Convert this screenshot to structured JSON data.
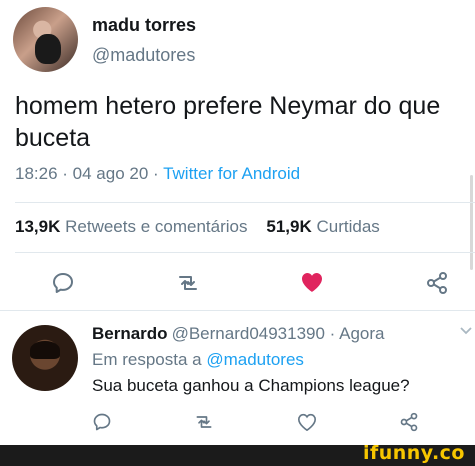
{
  "tweet": {
    "author_name": "madu torres",
    "author_handle": "@madutores",
    "text": "homem hetero prefere Neymar do que buceta",
    "time": "18:26 · 04 ago 20 · ",
    "source": "Twitter for Android",
    "retweets_count": "13,9K",
    "retweets_label": "Retweets e comentários",
    "likes_count": "51,9K",
    "likes_label": "Curtidas",
    "liked": true
  },
  "reply": {
    "author_name": "Bernardo",
    "author_handle": "@Bernard04931390 · Agora",
    "in_reply_prefix": "Em resposta a ",
    "in_reply_handle": "@madutores",
    "text": "Sua buceta ganhou a Champions league?"
  },
  "icons": {
    "reply": "comment-icon",
    "retweet": "retweet-icon",
    "like": "heart-icon",
    "share": "share-icon",
    "menu": "chevron-down-icon"
  },
  "colors": {
    "accent": "#1da1f2",
    "like": "#e0245e",
    "muted": "#657786",
    "watermark": "#f7c600"
  },
  "watermark": "ifunny.co"
}
